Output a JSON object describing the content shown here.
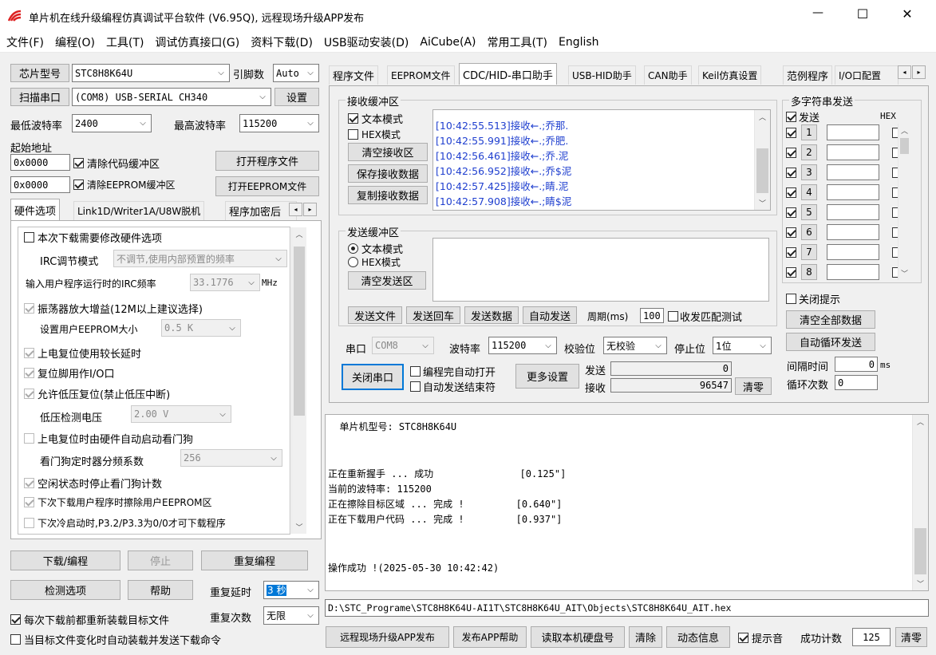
{
  "window": {
    "title": "单片机在线升级编程仿真调试平台软件 (V6.95Q), 远程现场升级APP发布",
    "minimize": "—",
    "maximize": "☐",
    "close": "✕"
  },
  "menu": [
    "文件(F)",
    "编程(O)",
    "工具(T)",
    "调试仿真接口(G)",
    "资料下载(D)",
    "USB驱动安装(D)",
    "AiCube(A)",
    "常用工具(T)",
    "English"
  ],
  "left": {
    "chip_btn": "芯片型号",
    "chip_value": "STC8H8K64U",
    "pins_label": "引脚数",
    "pins_value": "Auto",
    "scan_btn": "扫描串口",
    "port_value": "(COM8) USB-SERIAL CH340",
    "settings_btn": "设置",
    "min_baud_label": "最低波特率",
    "min_baud": "2400",
    "max_baud_label": "最高波特率",
    "max_baud": "115200",
    "start_addr_label": "起始地址",
    "addr1": "0x0000",
    "clear_code": "清除代码缓冲区",
    "open_prog": "打开程序文件",
    "addr2": "0x0000",
    "clear_eeprom": "清除EEPROM缓冲区",
    "open_eeprom": "打开EEPROM文件",
    "tabs": [
      "硬件选项",
      "Link1D/Writer1A/U8W脱机",
      "程序加密后"
    ],
    "hw": {
      "opt_modify": "本次下载需要修改硬件选项",
      "irc_mode_label": "IRC调节模式",
      "irc_mode": "不调节,使用内部预置的频率",
      "irc_freq_label": "输入用户程序运行时的IRC频率",
      "irc_freq": "33.1776",
      "irc_unit": "MHz",
      "osc_gain": "振荡器放大增益(12M以上建议选择)",
      "eeprom_size_label": "设置用户EEPROM大小",
      "eeprom_size": "0.5 K",
      "long_delay": "上电复位使用较长延时",
      "reset_io": "复位脚用作I/O口",
      "lvd": "允许低压复位(禁止低压中断)",
      "lvd_volt_label": "低压检测电压",
      "lvd_volt": "2.00 V",
      "wdt_auto": "上电复位时由硬件自动启动看门狗",
      "wdt_div_label": "看门狗定时器分频系数",
      "wdt_div": "256",
      "wdt_idle": "空闲状态时停止看门狗计数",
      "erase_eeprom": "下次下载用户程序时擦除用户EEPROM区",
      "cold_boot": "下次冷启动时,P3.2/P3.3为0/0才可下载程序"
    },
    "download_btn": "下载/编程",
    "stop_btn": "停止",
    "reprogram_btn": "重复编程",
    "detect_btn": "检测选项",
    "help_btn": "帮助",
    "repeat_delay_label": "重复延时",
    "repeat_delay": "3 秒",
    "reload_cb": "每次下载前都重新装载目标文件",
    "repeat_count_label": "重复次数",
    "repeat_count": "无限",
    "auto_cb": "当目标文件变化时自动装载并发送下载命令"
  },
  "right_tabs": [
    "程序文件",
    "EEPROM文件",
    "CDC/HID-串口助手",
    "USB-HID助手",
    "CAN助手",
    "Keil仿真设置",
    "范例程序",
    "I/O口配置"
  ],
  "serial": {
    "rx_group": "接收缓冲区",
    "rx_text_mode": "文本模式",
    "rx_hex_mode": "HEX模式",
    "clear_rx": "清空接收区",
    "save_rx": "保存接收数据",
    "copy_rx": "复制接收数据",
    "rx_lines": [
      "[10:42:55.513]接收←.;乔那.",
      "[10:42:55.991]接收←.;乔肥.",
      "[10:42:56.461]接收←.;乔.泥",
      "[10:42:56.952]接收←.;乔$泥",
      "[10:42:57.425]接收←.;睛.泥",
      "[10:42:57.908]接收←.;睛$泥"
    ],
    "tx_group": "发送缓冲区",
    "tx_text_mode": "文本模式",
    "tx_hex_mode": "HEX模式",
    "clear_tx": "清空发送区",
    "send_file": "发送文件",
    "send_back": "发送回车",
    "send_data": "发送数据",
    "auto_send": "自动发送",
    "period_label": "周期(ms)",
    "period": "100",
    "match_test": "收发匹配测试",
    "port_label": "串口",
    "port": "COM8",
    "baud_label": "波特率",
    "baud": "115200",
    "parity_label": "校验位",
    "parity": "无校验",
    "stop_label": "停止位",
    "stop": "1位",
    "close_port": "关闭串口",
    "auto_open": "编程完自动打开",
    "auto_end": "自动发送结束符",
    "more_settings": "更多设置",
    "send_label": "发送",
    "send_count": "0",
    "recv_label": "接收",
    "recv_count": "96547",
    "clear_count": "清零"
  },
  "multi": {
    "title": "多字符串发送",
    "send_hdr": "发送",
    "hex_hdr": "HEX",
    "items": [
      "1",
      "2",
      "3",
      "4",
      "5",
      "6",
      "7",
      "8"
    ],
    "close_tip": "关闭提示",
    "clear_all": "清空全部数据",
    "auto_loop": "自动循环发送",
    "interval_label": "间隔时间",
    "interval": "0",
    "interval_unit": "ms",
    "loop_label": "循环次数",
    "loop": "0"
  },
  "log": {
    "lines": [
      "  单片机型号: STC8H8K64U",
      "",
      "",
      "正在重新握手 ... 成功               [0.125\"]",
      "当前的波特率: 115200",
      "正在擦除目标区域 ... 完成 !         [0.640\"]",
      "正在下载用户代码 ... 完成 !         [0.937\"]",
      "",
      "",
      "操作成功 !(2025-05-30 10:42:42)"
    ]
  },
  "path": "D:\\STC_Programe\\STC8H8K64U-AI1T\\STC8H8K64U_AIT\\Objects\\STC8H8K64U_AIT.hex",
  "bottom": {
    "remote_publish": "远程现场升级APP发布",
    "publish_help": "发布APP帮助",
    "read_disk": "读取本机硬盘号",
    "clear": "清除",
    "dynamic": "动态信息",
    "beep": "提示音",
    "success_label": "成功计数",
    "success_count": "125",
    "clear_count": "清零"
  }
}
